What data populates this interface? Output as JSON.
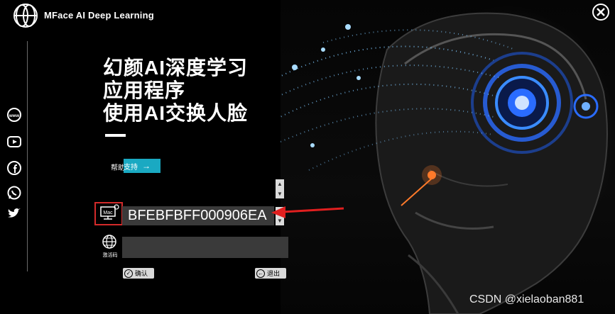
{
  "brand": {
    "name": "MFace AI Deep Learning"
  },
  "headline": {
    "lines": [
      "幻颜AI深度学习",
      "应用程序",
      "使用AI交换人脸"
    ]
  },
  "help": {
    "label": "帮助",
    "button": "支持"
  },
  "mac": {
    "icon_text": "Mac",
    "value": "BFEBFBFF000906EA"
  },
  "activation": {
    "label": "激活码",
    "value": ""
  },
  "buttons": {
    "ok": "确认",
    "exit": "退出"
  },
  "social": [
    "www-icon",
    "youtube-icon",
    "facebook-icon",
    "whatsapp-icon",
    "twitter-icon"
  ],
  "watermark": "CSDN @xielaoban881",
  "colors": {
    "accent": "#1aa9c2",
    "highlight": "#d32a2a",
    "glow": "#2a6cff"
  }
}
